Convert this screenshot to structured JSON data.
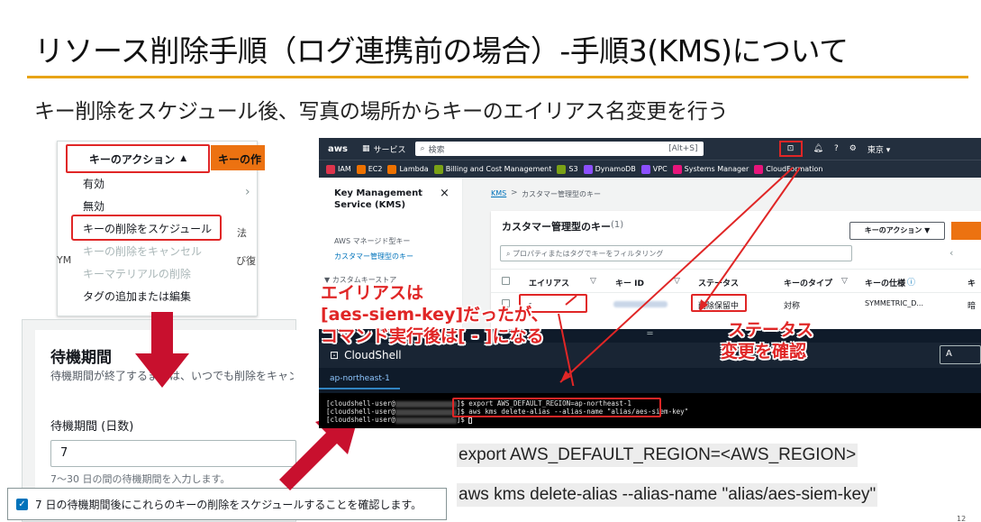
{
  "slide": {
    "title": "リソース削除手順（ログ連携前の場合）-手順3(KMS)について",
    "subtitle": "キー削除をスケジュール後、写真の場所からキーのエイリアス名変更を行う"
  },
  "dropdown": {
    "button_label": "キーのアクション",
    "next_button_label": "キーの作",
    "items": [
      {
        "label": "有効",
        "enabled": true
      },
      {
        "label": "無効",
        "enabled": true
      },
      {
        "label": "キーの削除をスケジュール",
        "enabled": true,
        "highlighted": true
      },
      {
        "label": "キーの削除をキャンセル",
        "enabled": false
      },
      {
        "label": "キーマテリアルの削除",
        "enabled": false
      },
      {
        "label": "タグの追加または編集",
        "enabled": true
      }
    ],
    "ghost_right_1": "法",
    "ghost_right_2": "び復",
    "ghost_left": "YM"
  },
  "wait_panel": {
    "title": "待機期間",
    "description": "待機期間が終了するまでは、いつでも削除をキャンセ",
    "field_label": "待機期間 (日数)",
    "field_value": "7",
    "field_hint": "7～30 日の間の待機期間を入力します。",
    "confirm_text": "7 日の待機期間後にこれらのキーの削除をスケジュールすることを確認します。"
  },
  "aws_console": {
    "logo": "aws",
    "services_label": "サービス",
    "search_placeholder": "検索",
    "search_shortcut": "[Alt+S]",
    "region": "東京 ▾",
    "favorites": [
      {
        "label": "IAM",
        "color": "#dd344c"
      },
      {
        "label": "EC2",
        "color": "#ed7100"
      },
      {
        "label": "Lambda",
        "color": "#ed7100"
      },
      {
        "label": "Billing and Cost Management",
        "color": "#7aa116"
      },
      {
        "label": "S3",
        "color": "#7aa116"
      },
      {
        "label": "DynamoDB",
        "color": "#8c4fff"
      },
      {
        "label": "VPC",
        "color": "#8c4fff"
      },
      {
        "label": "Systems Manager",
        "color": "#e7157b"
      },
      {
        "label": "CloudFormation",
        "color": "#e7157b"
      }
    ],
    "sidebar": {
      "title": "Key Management Service (KMS)",
      "items": [
        "AWS マネージド型キー",
        "カスタマー管理型のキー",
        "▼ カスタムキーストア"
      ]
    },
    "breadcrumb": {
      "root": "KMS",
      "sep": ">",
      "current": "カスタマー管理型のキー"
    },
    "table": {
      "title": "カスタマー管理型のキー",
      "count": "(1)",
      "action_button": "キーのアクション ▼",
      "filter_placeholder": "プロパティまたはタグでキーをフィルタリング",
      "headers": [
        "エイリアス",
        "キー ID",
        "ステータス",
        "キーのタイプ",
        "キーの仕様",
        "キ"
      ],
      "row": {
        "alias": "-",
        "status": "削除保留中",
        "type": "対称",
        "spec": "SYMMETRIC_D...",
        "extra": "暗"
      }
    }
  },
  "cloudshell": {
    "title": "CloudShell",
    "tab": "ap-northeast-1",
    "right_button": "A",
    "lines": [
      {
        "prompt": "[cloudshell-user@",
        "cmd": "]$ export AWS_DEFAULT_REGION=ap-northeast-1"
      },
      {
        "prompt": "[cloudshell-user@",
        "cmd": "]$ aws kms delete-alias --alias-name  \"alias/aes-siem-key\""
      },
      {
        "prompt": "[cloudshell-user@",
        "cmd": "]$ "
      }
    ]
  },
  "callouts": {
    "alias_note": [
      "エイリアスは",
      "[aes-siem-key]だったが、",
      "コマンド実行後は[ - ]になる"
    ],
    "status_note": [
      "ステータス",
      "変更を確認"
    ]
  },
  "commands": {
    "line1": "export AWS_DEFAULT_REGION=<AWS_REGION>",
    "line2": "aws kms delete-alias --alias-name  \"alias/aes-siem-key\""
  },
  "page_number": "12"
}
